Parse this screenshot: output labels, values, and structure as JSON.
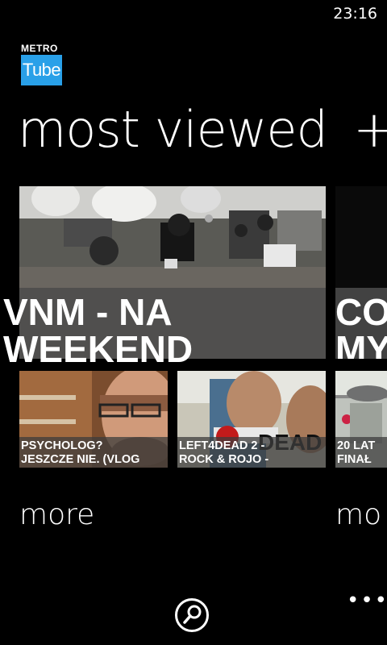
{
  "status": {
    "time": "23:16"
  },
  "app": {
    "logo_top": "METRO",
    "logo_box": "Tube",
    "logo_color": "#29a0e8"
  },
  "pivot": {
    "title": "most viewed",
    "next_title_fragment": "+"
  },
  "featured": {
    "title": "VNM - NA WEEKEND"
  },
  "featured_next": {
    "title_fragment_1": "CO",
    "title_fragment_2": "MY"
  },
  "videos": [
    {
      "title_line1": "PSYCHOLOG?",
      "title_line2": "JESZCZE NIE. (VLOG"
    },
    {
      "title_line1": "LEFT4DEAD 2 -",
      "title_line2": "ROCK & ROJO -"
    },
    {
      "title_line1": "20 LAT",
      "title_line2": "FINAŁ"
    }
  ],
  "more_label": "more",
  "more_label_next": "mo",
  "appbar": {
    "search_icon": "search-icon",
    "more_glyph": "•••"
  }
}
